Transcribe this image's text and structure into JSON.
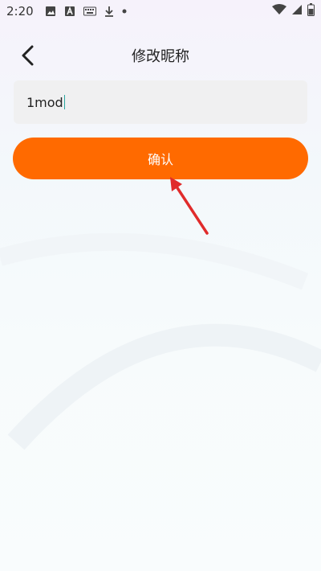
{
  "status_bar": {
    "time": "2:20",
    "left_icons": [
      "image-icon",
      "a-letter-icon",
      "keyboard-icon",
      "download-icon",
      "dot-icon"
    ],
    "right_icons": [
      "wifi-icon",
      "signal-icon",
      "battery-icon"
    ]
  },
  "header": {
    "title": "修改昵称",
    "back_icon": "chevron-left-icon"
  },
  "nickname_input": {
    "value": "1mod"
  },
  "confirm_button": {
    "label": "确认"
  },
  "colors": {
    "accent": "#ff6a00",
    "annotation_arrow": "#e02b2b",
    "input_bg": "#f0f0f1"
  }
}
